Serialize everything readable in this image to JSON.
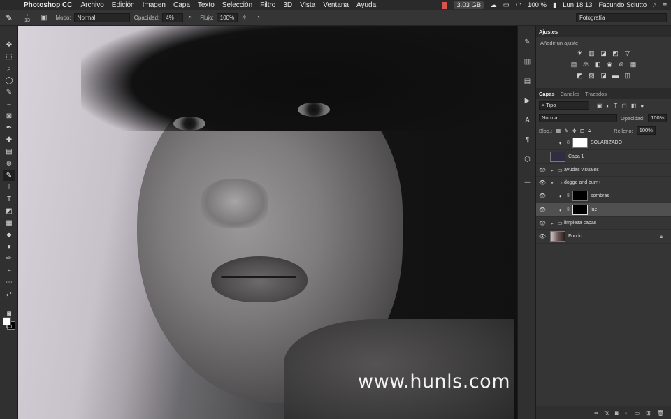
{
  "menubar": {
    "app_name": "Photoshop CC",
    "items": [
      "Archivo",
      "Edición",
      "Imagen",
      "Capa",
      "Texto",
      "Selección",
      "Filtro",
      "3D",
      "Vista",
      "Ventana",
      "Ayuda"
    ],
    "memory": "3.03 GB",
    "battery": "100 %",
    "clock": "Lun 18:13",
    "user": "Facundo Sciutto"
  },
  "options": {
    "brush_size": "13",
    "mode_label": "Modo:",
    "mode_value": "Normal",
    "opacity_label": "Opacidad:",
    "opacity_value": "4%",
    "flow_label": "Flujo:",
    "flow_value": "100%",
    "workspace": "Fotografía"
  },
  "canvas": {
    "watermark": "www.hunls.com"
  },
  "adjustments": {
    "tab": "Ajustes",
    "subtitle": "Añadir un ajuste"
  },
  "layers_panel": {
    "tabs": [
      "Capas",
      "Canales",
      "Trazados"
    ],
    "filter_kind": "Tipo",
    "blend_mode": "Normal",
    "opacity_label": "Opacidad:",
    "opacity_value": "100%",
    "lock_label": "Bloq.:",
    "fill_label": "Relleno:",
    "fill_value": "100%",
    "layers": [
      {
        "name": "SOLARIZADO"
      },
      {
        "name": "Capa 1"
      },
      {
        "name": "ayudas visuales"
      },
      {
        "name": "dogge and burn+"
      },
      {
        "name": "sombras"
      },
      {
        "name": "luz"
      },
      {
        "name": "limpieza capas"
      },
      {
        "name": "Fondo"
      }
    ]
  }
}
